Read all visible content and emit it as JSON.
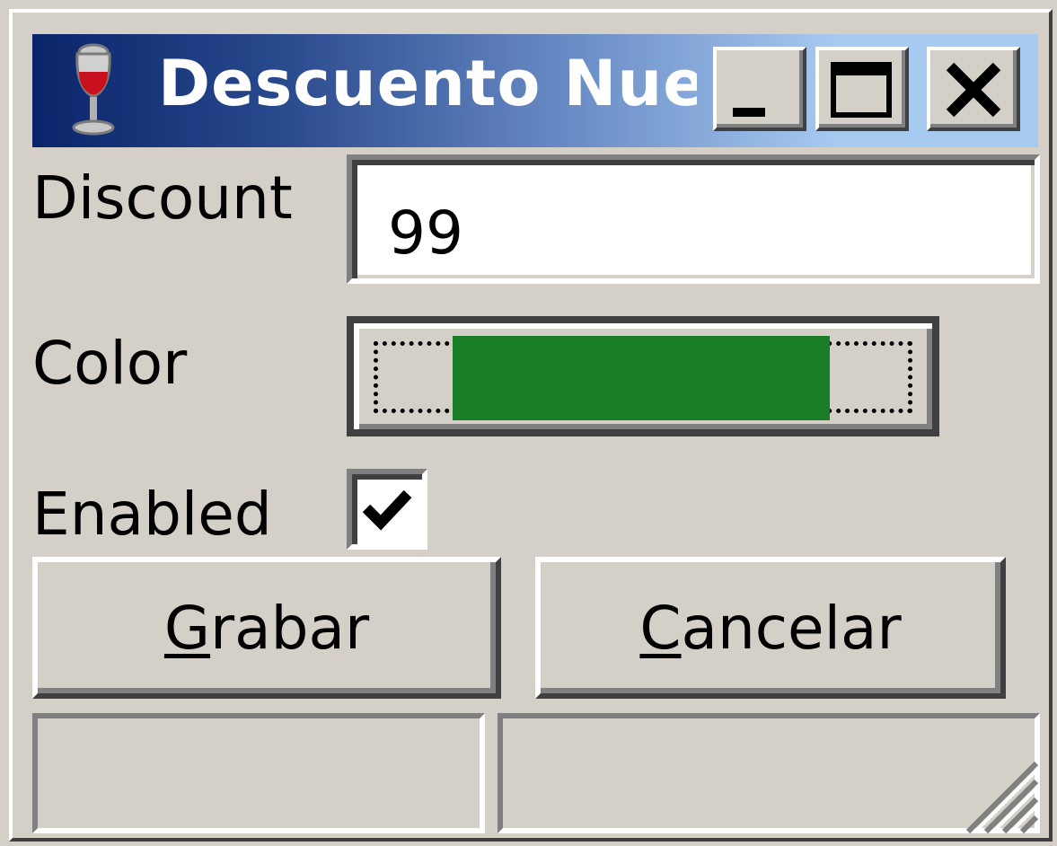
{
  "window": {
    "title": "Descuento Nue",
    "app_icon": "wine-glass-icon",
    "title_gradient_start": "#0a246a",
    "title_gradient_end": "#a6caf0"
  },
  "titlebar_buttons": {
    "minimize_icon": "minimize-icon",
    "maximize_icon": "maximize-icon",
    "close_icon": "close-icon"
  },
  "form": {
    "discount_label": "Discount",
    "discount_value": "99",
    "color_label": "Color",
    "color_value": "#1a7d27",
    "enabled_label": "Enabled",
    "enabled_checked": true
  },
  "buttons": {
    "save_label_mnemonic": "G",
    "save_label_rest": "rabar",
    "cancel_label_mnemonic": "C",
    "cancel_label_rest": "ancelar"
  },
  "statusbar": {
    "panel_1": "",
    "panel_2": "",
    "grip_icon": "resize-grip-icon"
  }
}
